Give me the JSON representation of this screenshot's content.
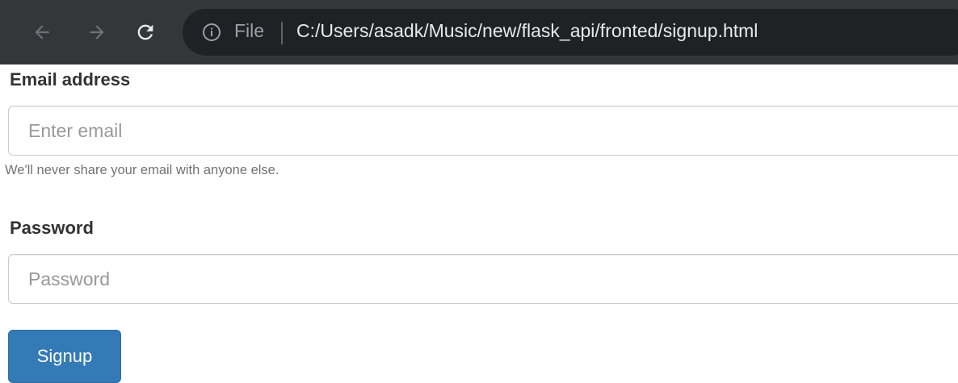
{
  "browser": {
    "back_icon": "arrow-left-icon",
    "forward_icon": "arrow-right-icon",
    "reload_icon": "reload-icon",
    "info_icon": "info-icon",
    "scheme_label": "File",
    "url": "C:/Users/asadk/Music/new/flask_api/fronted/signup.html"
  },
  "form": {
    "email": {
      "label": "Email address",
      "placeholder": "Enter email",
      "value": "",
      "help": "We'll never share your email with anyone else."
    },
    "password": {
      "label": "Password",
      "placeholder": "Password",
      "value": ""
    },
    "submit_label": "Signup"
  },
  "colors": {
    "toolbar": "#35363a",
    "omnibox": "#202124",
    "primary_button": "#337ab7"
  }
}
